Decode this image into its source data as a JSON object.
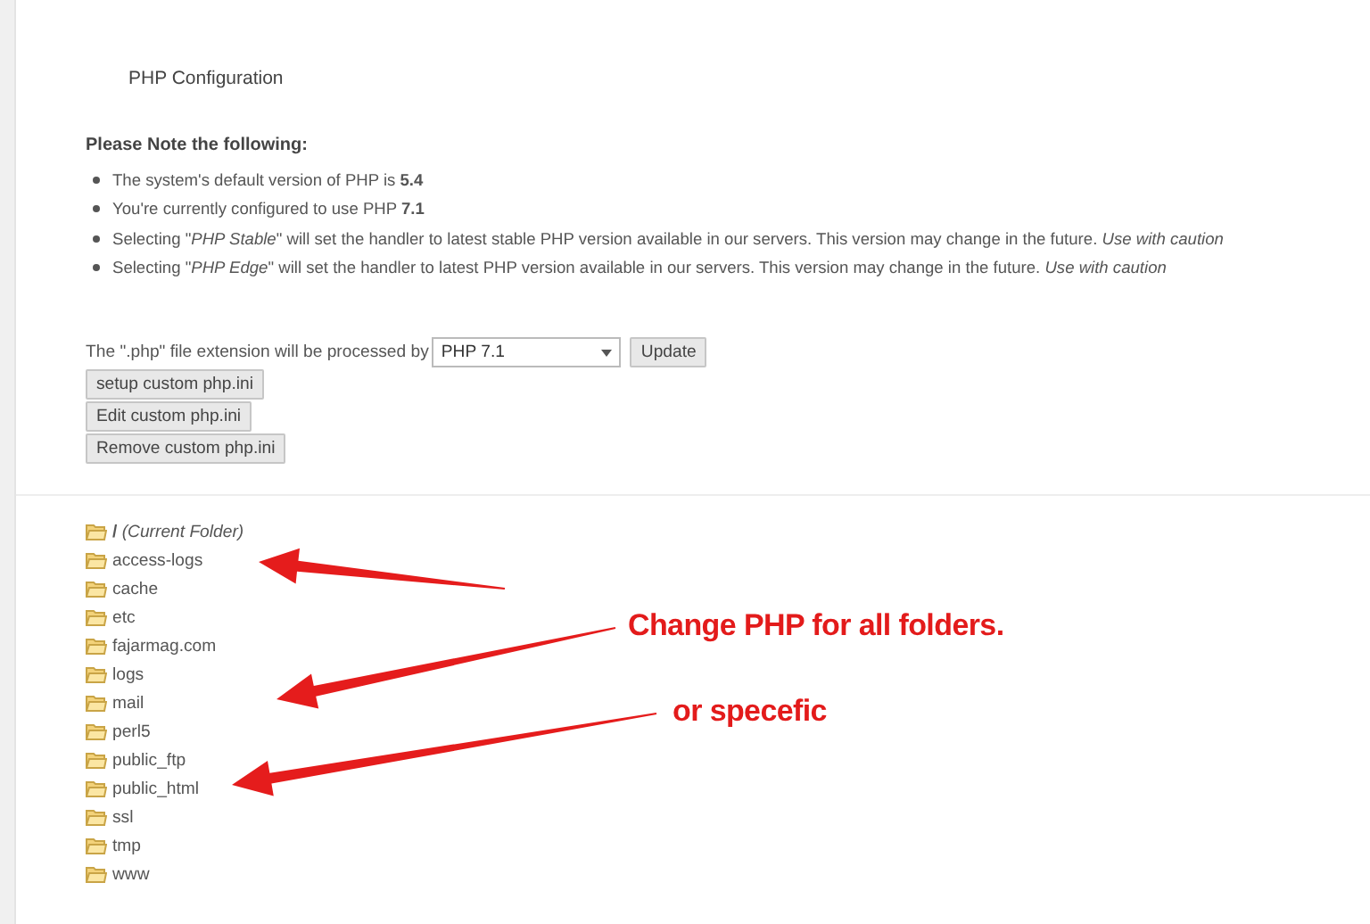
{
  "page_title": "PHP Configuration",
  "notes": {
    "heading": "Please Note the following:",
    "items": [
      "The system's default version of PHP is **5.4**",
      "You're currently configured to use PHP **7.1**",
      "Selecting \"*PHP Stable*\" will set the handler to latest stable PHP version available in our servers. This version may change in the future. *Use with caution*",
      "Selecting \"*PHP Edge*\" will set the handler to latest PHP version available in our servers. This version may change in the future. *Use with caution*"
    ]
  },
  "handler": {
    "label": "The \".php\" file extension will be processed by",
    "value": "PHP 7.1",
    "button": "Update"
  },
  "buttons": [
    "setup custom php.ini",
    "Edit custom php.ini",
    "Remove custom php.ini"
  ],
  "folders": [
    {
      "name": "**/** *(Current Folder)*"
    },
    {
      "name": "access-logs"
    },
    {
      "name": "cache"
    },
    {
      "name": "etc"
    },
    {
      "name": "fajarmag.com"
    },
    {
      "name": "logs"
    },
    {
      "name": "mail"
    },
    {
      "name": "perl5"
    },
    {
      "name": "public_ftp"
    },
    {
      "name": "public_html"
    },
    {
      "name": "ssl"
    },
    {
      "name": "tmp"
    },
    {
      "name": "www"
    }
  ],
  "annotations": [
    "Change PHP for all folders.",
    "or specefic"
  ]
}
